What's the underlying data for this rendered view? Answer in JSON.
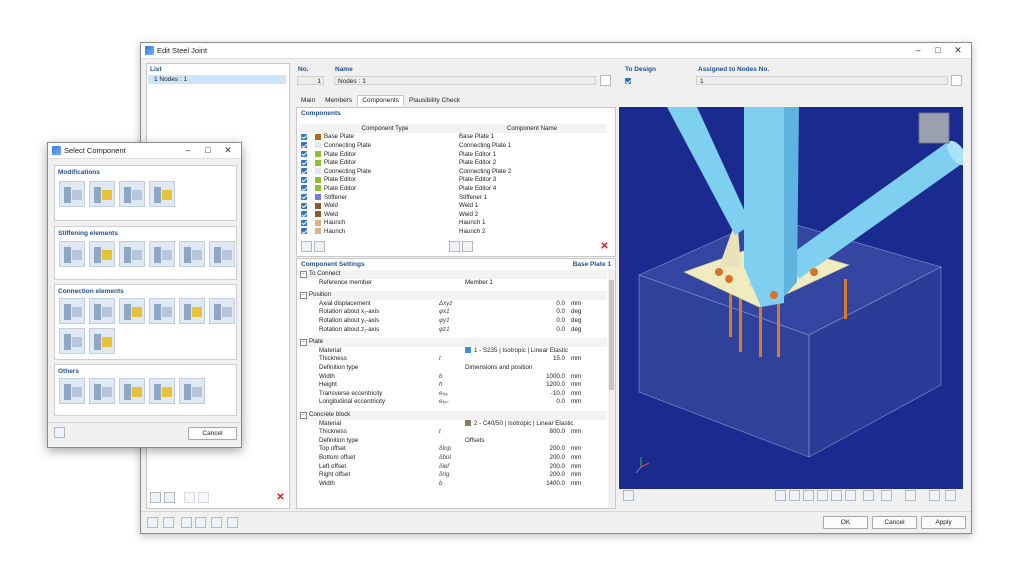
{
  "main_window": {
    "title": "Edit Steel Joint",
    "list_header": "List",
    "list_items": [
      "1  Nodes : 1"
    ],
    "no_label": "No.",
    "no_value": "1",
    "name_label": "Name",
    "name_value": "Nodes : 1",
    "to_design_label": "To Design",
    "assigned_label": "Assigned to Nodes No.",
    "assigned_value": "1",
    "tabs": [
      "Main",
      "Members",
      "Components",
      "Plausibility Check"
    ],
    "components_header": "Components",
    "col_type": "Component Type",
    "col_name": "Component Name",
    "components": [
      {
        "type": "Base Plate",
        "name": "Base Plate 1",
        "color": "#b5651d"
      },
      {
        "type": "Connecting Plate",
        "name": "Connecting Plate 1",
        "color": "#e6e6f2"
      },
      {
        "type": "Plate Editor",
        "name": "Plate Editor 1",
        "color": "#8fbf2a"
      },
      {
        "type": "Plate Editor",
        "name": "Plate Editor 2",
        "color": "#8fbf2a"
      },
      {
        "type": "Connecting Plate",
        "name": "Connecting Plate 2",
        "color": "#e6e6f2"
      },
      {
        "type": "Plate Editor",
        "name": "Plate Editor 3",
        "color": "#8fbf2a"
      },
      {
        "type": "Plate Editor",
        "name": "Plate Editor 4",
        "color": "#8fbf2a"
      },
      {
        "type": "Stiffener",
        "name": "Stiffener 1",
        "color": "#7a7ad8"
      },
      {
        "type": "Weld",
        "name": "Weld 1",
        "color": "#8c5a2a"
      },
      {
        "type": "Weld",
        "name": "Weld 2",
        "color": "#8c5a2a"
      },
      {
        "type": "Haunch",
        "name": "Haunch 1",
        "color": "#e0b080"
      },
      {
        "type": "Haunch",
        "name": "Haunch 2",
        "color": "#e0b080"
      }
    ],
    "settings_header": "Component Settings",
    "settings_current": "Base Plate 1",
    "settings": {
      "to_connect": "To Connect",
      "reference_member_label": "Reference member",
      "reference_member_value": "Member 1",
      "position": "Position",
      "axial_label": "Axial displacement",
      "axial_sym": "Δxyz",
      "axial_value": "0.0",
      "axial_unit": "mm",
      "rot1_label": "Rotation about x₁-axis",
      "rot1_sym": "φx1",
      "rot1_value": "0.0",
      "rot1_unit": "deg",
      "rot2_label": "Rotation about y₁-axis",
      "rot2_sym": "φy1",
      "rot2_value": "0.0",
      "rot2_unit": "deg",
      "rot3_label": "Rotation about z₁-axis",
      "rot3_sym": "φz1",
      "rot3_value": "0.0",
      "rot3_unit": "deg",
      "plate": "Plate",
      "material_label": "Material",
      "material_value": "1 - S235 | Isotropic | Linear Elastic",
      "material_color": "#3b8fe0",
      "thickness_label": "Thickness",
      "thickness_sym": "t",
      "thickness_value": "15.0",
      "thickness_unit": "mm",
      "deftype_label": "Definition type",
      "deftype_value": "Dimensions and position",
      "width_label": "Width",
      "width_sym": "b",
      "width_value": "1000.0",
      "width_unit": "mm",
      "height_label": "Height",
      "height_sym": "h",
      "height_value": "1200.0",
      "height_unit": "mm",
      "tecc_label": "Transverse eccentricity",
      "tecc_sym": "eₜᵣₐ",
      "tecc_value": "-10.0",
      "tecc_unit": "mm",
      "lecc_label": "Longitudinal eccentricity",
      "lecc_sym": "eₗₒₙ",
      "lecc_value": "0.0",
      "lecc_unit": "mm",
      "concrete": "Concrete block",
      "cmaterial_label": "Material",
      "cmaterial_value": "2 - C40/50 | Isotropic | Linear Elastic",
      "cmaterial_color": "#8a7a60",
      "cthick_label": "Thickness",
      "cthick_sym": "t",
      "cthick_value": "800.0",
      "cthick_unit": "mm",
      "cdef_label": "Definition type",
      "cdef_value": "Offsets",
      "top_label": "Top offset",
      "top_sym": "δtop",
      "top_value": "200.0",
      "top_unit": "mm",
      "bot_label": "Bottom offset",
      "bot_sym": "δbot",
      "bot_value": "200.0",
      "bot_unit": "mm",
      "left_label": "Left offset",
      "left_sym": "δlef",
      "left_value": "200.0",
      "left_unit": "mm",
      "right_label": "Right offset",
      "right_sym": "δrig",
      "right_value": "200.0",
      "right_unit": "mm",
      "cwidth_label": "Width",
      "cwidth_sym": "b",
      "cwidth_value": "1400.0",
      "cwidth_unit": "mm"
    },
    "ok_label": "OK",
    "cancel_label": "Cancel",
    "apply_label": "Apply"
  },
  "select_dialog": {
    "title": "Select Component",
    "sections": [
      "Modifications",
      "Stiffening elements",
      "Connection elements",
      "Others"
    ],
    "cancel_label": "Cancel"
  },
  "colors": {
    "viewport_bg": "#1a2a8f",
    "steel": "#7fd0f0",
    "plate": "#f4efc4"
  }
}
